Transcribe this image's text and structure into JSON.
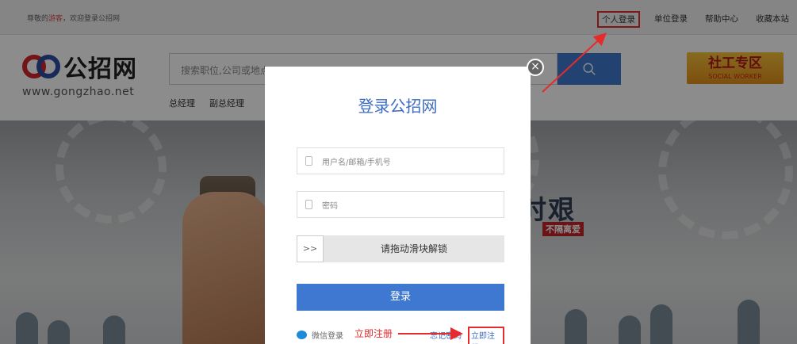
{
  "topbar": {
    "greeting_prefix": "尊敬的",
    "greeting_guest": "游客",
    "greeting_suffix": "，欢迎登录公招网",
    "links": [
      "个人登录",
      "单位登录",
      "帮助中心",
      "收藏本站"
    ]
  },
  "header": {
    "logo_cn": "公招网",
    "logo_url": "www.gongzhao.net",
    "search_placeholder": "搜索职位,公司或地点",
    "hot_keywords": [
      "总经理",
      "副总经理"
    ],
    "social_cn": "社工专区",
    "social_en": "SOCIAL WORKER"
  },
  "banner": {
    "slogan": "时艰",
    "slogan2": "不隔离爱"
  },
  "login": {
    "title": "登录公招网",
    "username_placeholder": "用户名/邮箱/手机号",
    "password_placeholder": "密码",
    "slider_knob": ">>",
    "slider_text": "请拖动滑块解锁",
    "submit": "登录",
    "wechat_login": "微信登录",
    "forgot": "忘记密码",
    "register": "立即注册",
    "close": "×"
  },
  "annotation": {
    "text": "立即注册",
    "color": "#e52b2b"
  },
  "colors": {
    "accent": "#3f78d0",
    "highlight": "#e52b2b"
  }
}
